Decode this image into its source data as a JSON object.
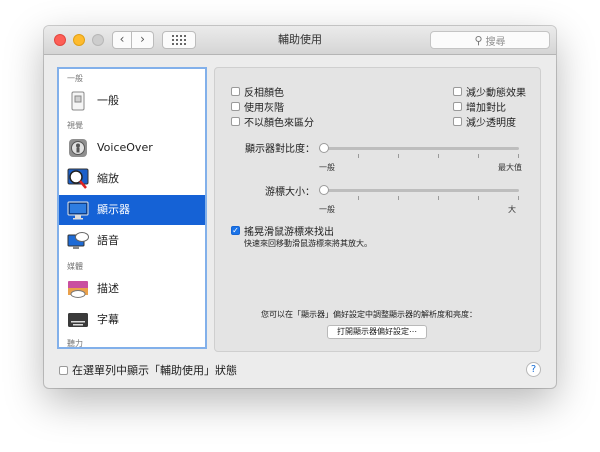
{
  "window": {
    "title": "輔助使用",
    "search_placeholder": "搜尋",
    "back_glyph": "‹",
    "forward_glyph": "›"
  },
  "sidebar": {
    "sections": {
      "general": "一般",
      "vision": "視覺",
      "media": "媒體",
      "hearing": "聽力"
    },
    "items": [
      {
        "label": "一般",
        "icon": "general-switch-icon",
        "selected": false
      },
      {
        "label": "VoiceOver",
        "icon": "voiceover-icon",
        "selected": false
      },
      {
        "label": "縮放",
        "icon": "zoom-icon",
        "selected": false
      },
      {
        "label": "顯示器",
        "icon": "display-icon",
        "selected": true
      },
      {
        "label": "語音",
        "icon": "speech-icon",
        "selected": false
      },
      {
        "label": "描述",
        "icon": "descriptions-icon",
        "selected": false
      },
      {
        "label": "字幕",
        "icon": "captions-icon",
        "selected": false
      }
    ]
  },
  "display": {
    "options_left": [
      {
        "label": "反相顏色",
        "checked": false
      },
      {
        "label": "使用灰階",
        "checked": false
      },
      {
        "label": "不以顏色來區分",
        "checked": false
      }
    ],
    "options_right": [
      {
        "label": "減少動態效果",
        "checked": false
      },
      {
        "label": "增加對比",
        "checked": false
      },
      {
        "label": "減少透明度",
        "checked": false
      }
    ],
    "contrast": {
      "label": "顯示器對比度：",
      "min_label": "一般",
      "max_label": "最大值",
      "value": 0
    },
    "cursor": {
      "label": "游標大小：",
      "min_label": "一般",
      "max_label": "大",
      "value": 0
    },
    "shake": {
      "label": "搖晃滑鼠游標來找出",
      "checked": true,
      "description": "快速來回移動滑鼠游標來將其放大。"
    },
    "note": "您可以在「顯示器」偏好設定中調整顯示器的解析度和亮度：",
    "open_button": "打開顯示器偏好設定⋯"
  },
  "footer": {
    "menu_bar_checkbox": "在選單列中顯示「輔助使用」狀態",
    "menu_bar_checked": false,
    "help": "?"
  },
  "colors": {
    "accent": "#1562d6",
    "checkbox": "#1a73e8"
  }
}
